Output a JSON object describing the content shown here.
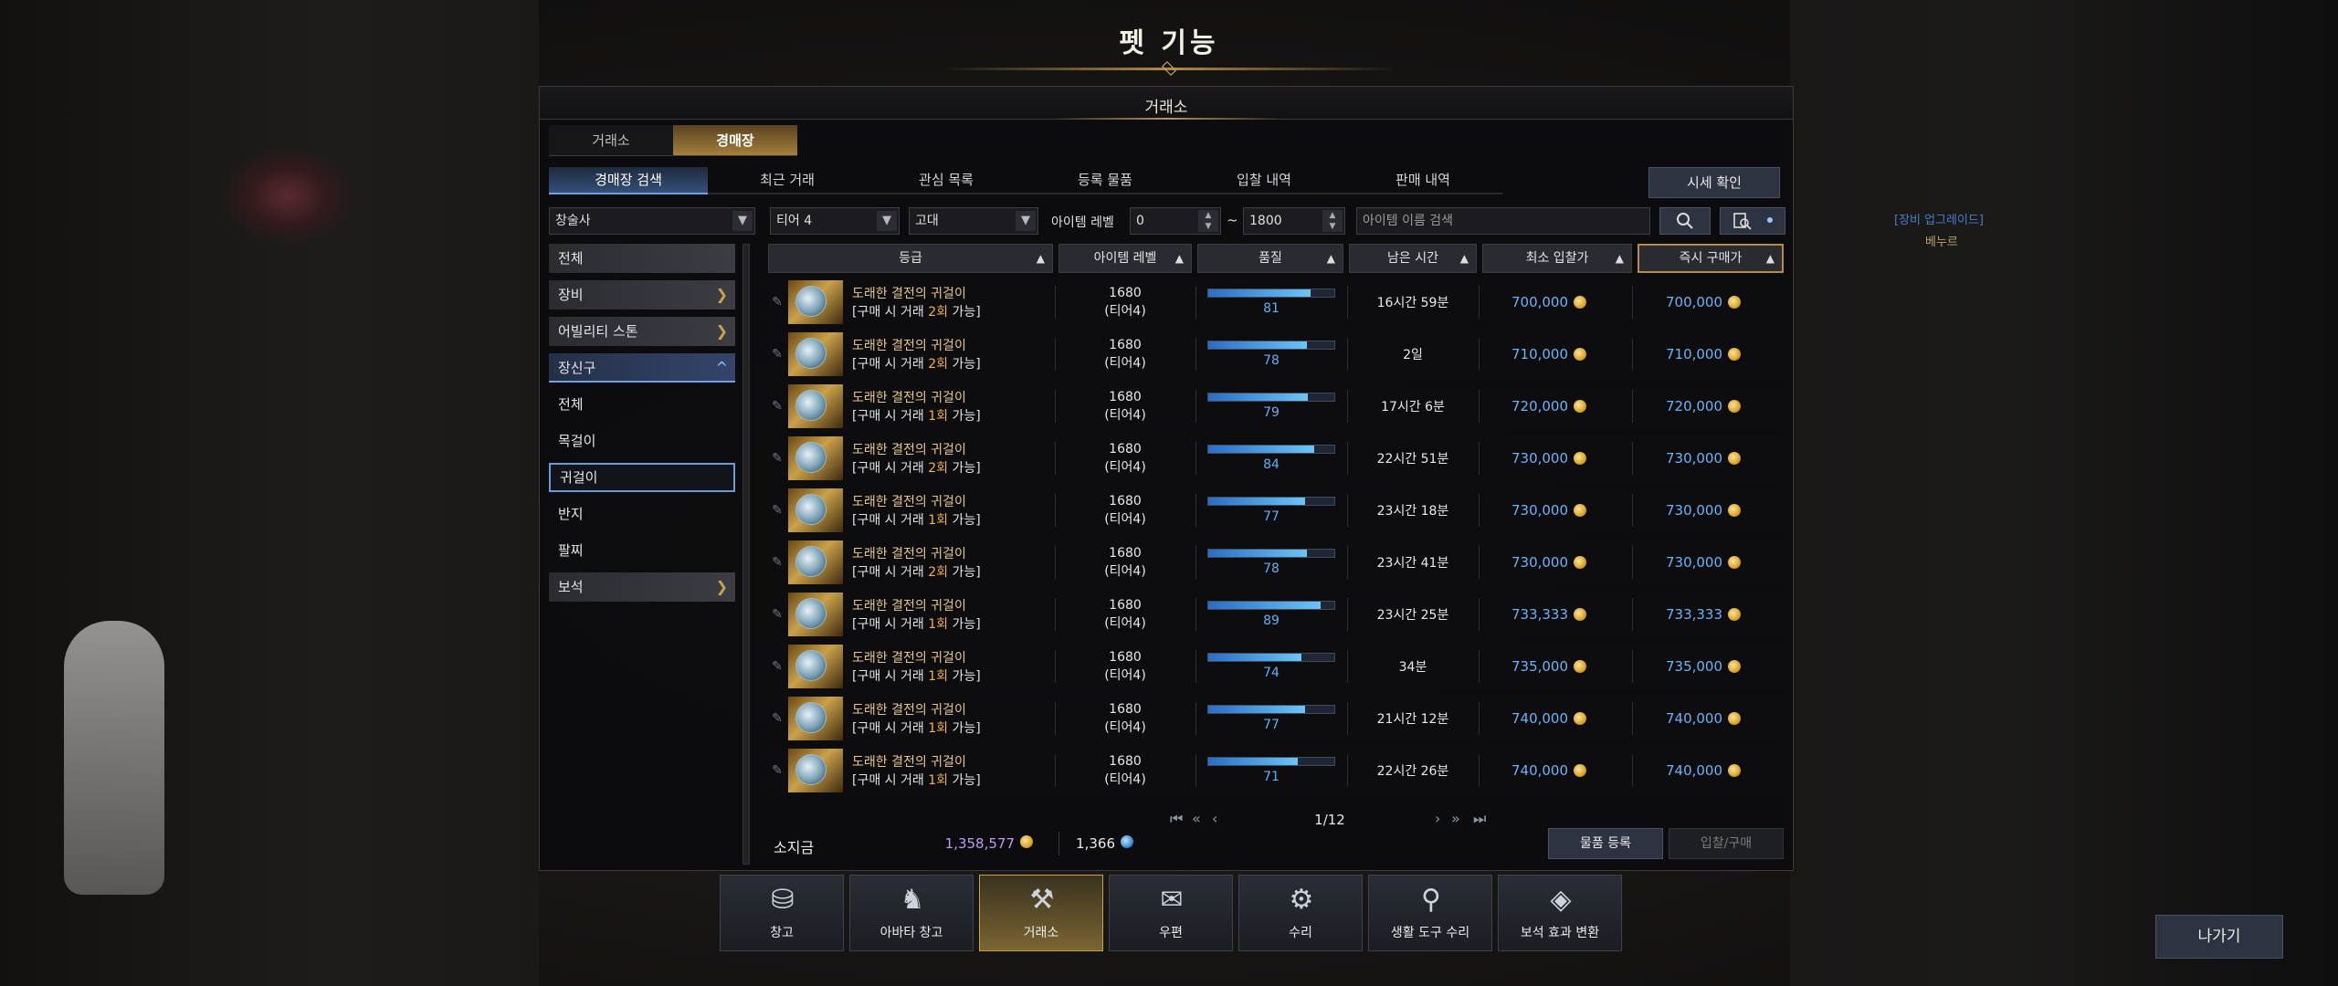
{
  "window_title": "펫 기능",
  "panel_title": "거래소",
  "top_tabs": [
    "거래소",
    "경매장"
  ],
  "sub_tabs": [
    "경매장 검색",
    "최근 거래",
    "관심 목록",
    "등록 물품",
    "입찰 내역",
    "판매 내역"
  ],
  "price_check": "시세 확인",
  "filters": {
    "class": "창술사",
    "tier": "티어 4",
    "grade": "고대",
    "level_label": "아이템 레벨",
    "level_min": "0",
    "tilde": "~",
    "level_max": "1800",
    "search_placeholder": "아이템 이름 검색"
  },
  "categories": {
    "all": "전체",
    "equipment": "장비",
    "ability_stone": "어빌리티 스톤",
    "accessory": "장신구",
    "sub_all": "전체",
    "necklace": "목걸이",
    "earring": "귀걸이",
    "ring": "반지",
    "bracelet": "팔찌",
    "gem": "보석"
  },
  "columns": [
    "등급",
    "아이템 레벨",
    "품질",
    "남은 시간",
    "최소 입찰가",
    "즉시 구매가"
  ],
  "listings": [
    {
      "name": "도래한 결전의 귀걸이",
      "trade_pre": "[구매 시 거래 ",
      "trade_count": "2회",
      "trade_post": " 가능]",
      "level": "1680",
      "tier": "(티어4)",
      "quality": 81,
      "time": "16시간 59분",
      "min_bid": "700,000",
      "buy_now": "700,000"
    },
    {
      "name": "도래한 결전의 귀걸이",
      "trade_pre": "[구매 시 거래 ",
      "trade_count": "2회",
      "trade_post": " 가능]",
      "level": "1680",
      "tier": "(티어4)",
      "quality": 78,
      "time": "2일",
      "min_bid": "710,000",
      "buy_now": "710,000"
    },
    {
      "name": "도래한 결전의 귀걸이",
      "trade_pre": "[구매 시 거래 ",
      "trade_count": "1회",
      "trade_post": " 가능]",
      "level": "1680",
      "tier": "(티어4)",
      "quality": 79,
      "time": "17시간 6분",
      "min_bid": "720,000",
      "buy_now": "720,000"
    },
    {
      "name": "도래한 결전의 귀걸이",
      "trade_pre": "[구매 시 거래 ",
      "trade_count": "2회",
      "trade_post": " 가능]",
      "level": "1680",
      "tier": "(티어4)",
      "quality": 84,
      "time": "22시간 51분",
      "min_bid": "730,000",
      "buy_now": "730,000"
    },
    {
      "name": "도래한 결전의 귀걸이",
      "trade_pre": "[구매 시 거래 ",
      "trade_count": "1회",
      "trade_post": " 가능]",
      "level": "1680",
      "tier": "(티어4)",
      "quality": 77,
      "time": "23시간 18분",
      "min_bid": "730,000",
      "buy_now": "730,000"
    },
    {
      "name": "도래한 결전의 귀걸이",
      "trade_pre": "[구매 시 거래 ",
      "trade_count": "2회",
      "trade_post": " 가능]",
      "level": "1680",
      "tier": "(티어4)",
      "quality": 78,
      "time": "23시간 41분",
      "min_bid": "730,000",
      "buy_now": "730,000"
    },
    {
      "name": "도래한 결전의 귀걸이",
      "trade_pre": "[구매 시 거래 ",
      "trade_count": "1회",
      "trade_post": " 가능]",
      "level": "1680",
      "tier": "(티어4)",
      "quality": 89,
      "time": "23시간 25분",
      "min_bid": "733,333",
      "buy_now": "733,333"
    },
    {
      "name": "도래한 결전의 귀걸이",
      "trade_pre": "[구매 시 거래 ",
      "trade_count": "1회",
      "trade_post": " 가능]",
      "level": "1680",
      "tier": "(티어4)",
      "quality": 74,
      "time": "34분",
      "min_bid": "735,000",
      "buy_now": "735,000"
    },
    {
      "name": "도래한 결전의 귀걸이",
      "trade_pre": "[구매 시 거래 ",
      "trade_count": "1회",
      "trade_post": " 가능]",
      "level": "1680",
      "tier": "(티어4)",
      "quality": 77,
      "time": "21시간 12분",
      "min_bid": "740,000",
      "buy_now": "740,000"
    },
    {
      "name": "도래한 결전의 귀걸이",
      "trade_pre": "[구매 시 거래 ",
      "trade_count": "1회",
      "trade_post": " 가능]",
      "level": "1680",
      "tier": "(티어4)",
      "quality": 71,
      "time": "22시간 26분",
      "min_bid": "740,000",
      "buy_now": "740,000"
    }
  ],
  "pagination": "1/12",
  "wallet": {
    "label": "소지금",
    "gold": "1,358,577",
    "crystal": "1,366"
  },
  "actions": {
    "register": "물품 등록",
    "bid_buy": "입찰/구매"
  },
  "dock": [
    "창고",
    "아바타 창고",
    "거래소",
    "우편",
    "수리",
    "생활 도구 수리",
    "보석 효과 변환"
  ],
  "dock_icons": [
    "chest-icon",
    "avatar-icon",
    "gavel-icon",
    "mail-icon",
    "anvil-icon",
    "tool-icon",
    "gem-icon"
  ],
  "exit": "나가기",
  "side_note": "[장비 업그레이드]",
  "side_name": "베누르",
  "colors": {
    "accent_gold": "#c9a24d",
    "accent_blue": "#6ea0e6",
    "price_blue": "#6ab4f6",
    "gold_purple": "#b89df2"
  }
}
